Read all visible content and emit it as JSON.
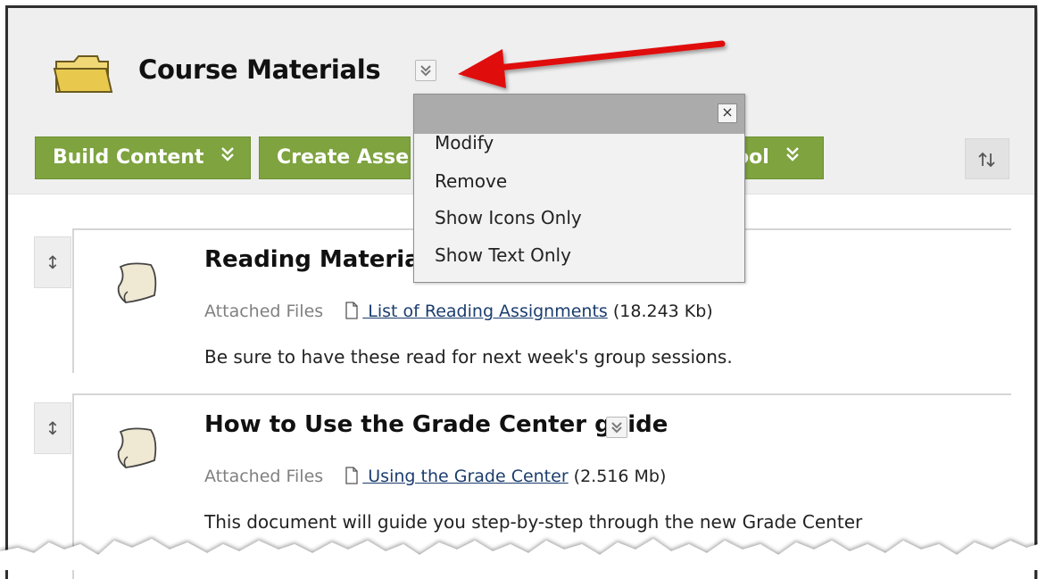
{
  "header": {
    "title": "Course Materials"
  },
  "toolbar": {
    "build_label": "Build Content",
    "assess_label": "Create Asses",
    "tool_label": "ool"
  },
  "menu": {
    "close_glyph": "×",
    "items": [
      {
        "label": "Modify"
      },
      {
        "label": "Remove"
      },
      {
        "label": "Show Icons Only"
      },
      {
        "label": "Show Text Only"
      }
    ]
  },
  "items": [
    {
      "title": "Reading Material",
      "attached_label": "Attached Files",
      "file_name": " List of Reading Assignments",
      "file_size": " (18.243 Kb)",
      "description": "Be sure to have these read for next week's group sessions."
    },
    {
      "title": "How to Use the Grade Center guide",
      "attached_label": "Attached Files",
      "file_name": " Using the Grade Center",
      "file_size": " (2.516 Mb)",
      "description": "This document will guide you step-by-step through the new Grade Center"
    }
  ],
  "icons": {
    "folder": "folder-icon",
    "document": "document-icon",
    "file": "file-icon",
    "sort": "sort-icon",
    "drag": "drag-handle-icon",
    "chevron": "chevron-down-icon",
    "arrow": "red-arrow-annotation"
  },
  "colors": {
    "toolbar_green": "#7ea33f",
    "link_blue": "#1b3d6e",
    "arrow_red": "#e01010",
    "header_bg": "#efefef"
  }
}
